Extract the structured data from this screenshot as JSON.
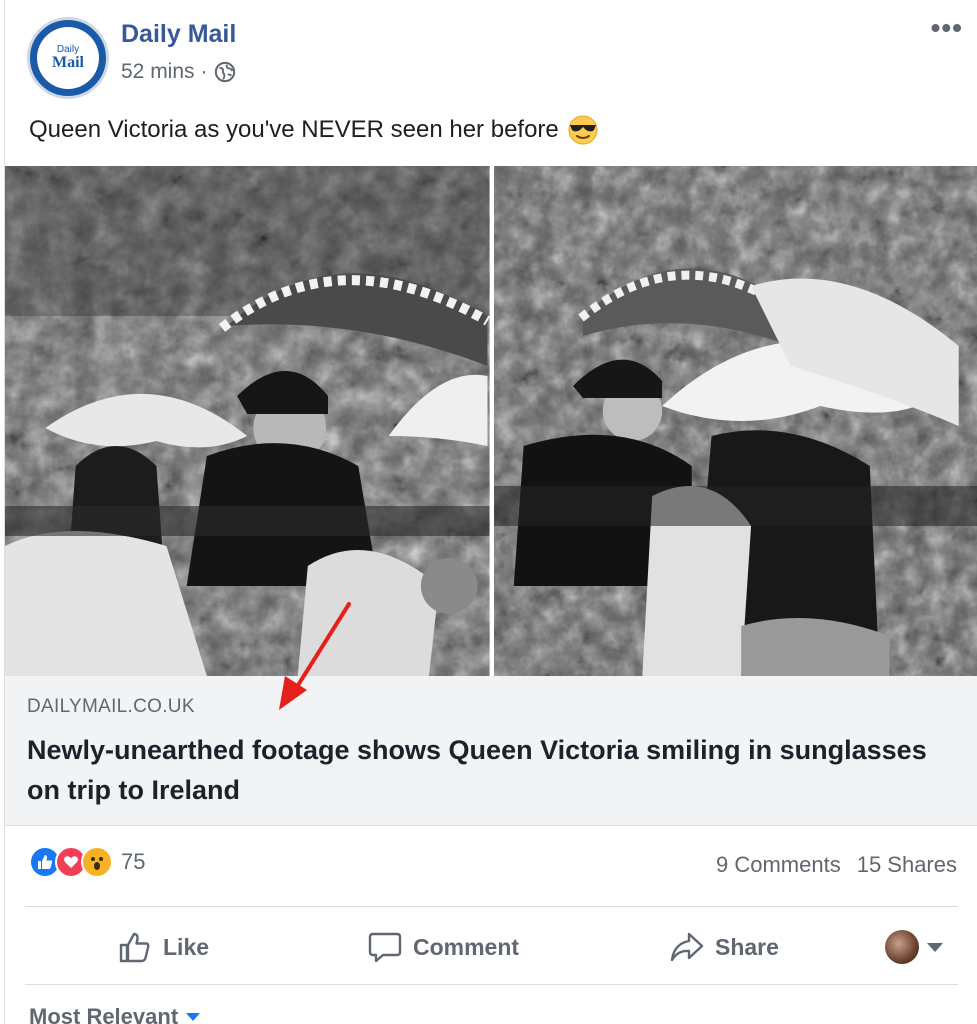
{
  "post": {
    "page_name": "Daily Mail",
    "avatar": {
      "line1": "Daily",
      "line2": "Mail"
    },
    "time": "52 mins",
    "separator": "·",
    "privacy_icon": "globe-icon",
    "more_icon": "•••",
    "caption": "Queen Victoria as you've NEVER seen her before",
    "caption_emoji": "sunglasses-face-emoji"
  },
  "link": {
    "domain": "DAILYMAIL.CO.UK",
    "headline": "Newly-unearthed footage shows Queen Victoria smiling in sunglasses on trip to Ireland"
  },
  "engagement": {
    "reaction_icons": [
      "like-reaction-icon",
      "love-reaction-icon",
      "wow-reaction-icon"
    ],
    "reaction_count": "75",
    "comments": "9 Comments",
    "shares": "15 Shares"
  },
  "actions": {
    "like": "Like",
    "comment": "Comment",
    "share": "Share"
  },
  "comments_sort": {
    "label": "Most Relevant"
  },
  "colors": {
    "brand_blue": "#385898",
    "like_blue": "#1877f2",
    "love_red": "#f33e58",
    "wow_yellow": "#f7b125",
    "annotation_red": "#e3201b"
  }
}
